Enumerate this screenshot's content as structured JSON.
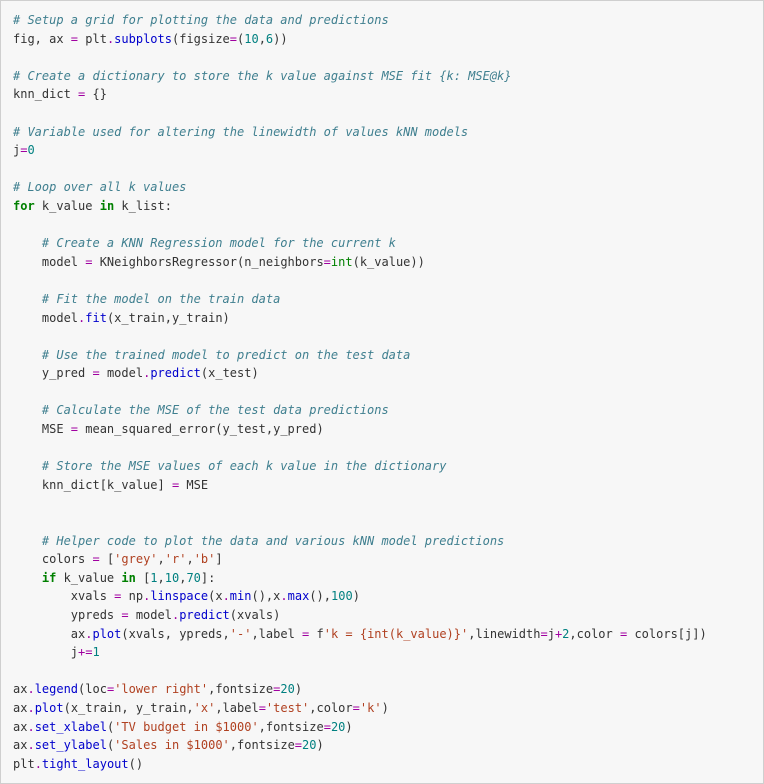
{
  "code": {
    "c1": "# Setup a grid for plotting the data and predictions",
    "l2a": "fig, ax ",
    "l2eq": "=",
    "l2b": " plt",
    "l2dot": ".",
    "l2fn": "subplots",
    "l2p1": "(figsize",
    "l2eq2": "=",
    "l2p2": "(",
    "l2n1": "10",
    "l2comma": ",",
    "l2n2": "6",
    "l2p3": "))",
    "c3": "# Create a dictionary to store the k value against MSE fit {k: MSE@k}",
    "l4a": "knn_dict ",
    "l4eq": "=",
    "l4b": " {}",
    "c5": "# Variable used for altering the linewidth of values kNN models",
    "l6a": "j",
    "l6eq": "=",
    "l6n": "0",
    "c7": "# Loop over all k values",
    "l8for": "for",
    "l8a": " k_value ",
    "l8in": "in",
    "l8b": " k_list:",
    "c9": "    # Create a KNN Regression model for the current k",
    "l10a": "    model ",
    "l10eq": "=",
    "l10b": " KNeighborsRegressor(n_neighbors",
    "l10eq2": "=",
    "l10int": "int",
    "l10c": "(k_value))",
    "c11": "    # Fit the model on the train data",
    "l12a": "    model",
    "l12dot": ".",
    "l12fn": "fit",
    "l12b": "(x_train,y_train)",
    "c13": "    # Use the trained model to predict on the test data",
    "l14a": "    y_pred ",
    "l14eq": "=",
    "l14b": " model",
    "l14dot": ".",
    "l14fn": "predict",
    "l14c": "(x_test)",
    "c15": "    # Calculate the MSE of the test data predictions",
    "l16a": "    MSE ",
    "l16eq": "=",
    "l16b": " mean_squared_error(y_test,y_pred)",
    "c17": "    # Store the MSE values of each k value in the dictionary",
    "l18a": "    knn_dict[k_value] ",
    "l18eq": "=",
    "l18b": " MSE",
    "c19": "    # Helper code to plot the data and various kNN model predictions",
    "l20a": "    colors ",
    "l20eq": "=",
    "l20b": " [",
    "l20s1": "'grey'",
    "l20c1": ",",
    "l20s2": "'r'",
    "l20c2": ",",
    "l20s3": "'b'",
    "l20b2": "]",
    "l21a": "    ",
    "l21if": "if",
    "l21b": " k_value ",
    "l21in": "in",
    "l21c": " [",
    "l21n1": "1",
    "l21c1": ",",
    "l21n2": "10",
    "l21c2": ",",
    "l21n3": "70",
    "l21d": "]:",
    "l22a": "        xvals ",
    "l22eq": "=",
    "l22b": " np",
    "l22dot": ".",
    "l22fn": "linspace",
    "l22c": "(x",
    "l22dot2": ".",
    "l22fn2": "min",
    "l22d": "(),x",
    "l22dot3": ".",
    "l22fn3": "max",
    "l22e": "(),",
    "l22n": "100",
    "l22f": ")",
    "l23a": "        ypreds ",
    "l23eq": "=",
    "l23b": " model",
    "l23dot": ".",
    "l23fn": "predict",
    "l23c": "(xvals)",
    "l24a": "        ax",
    "l24dot": ".",
    "l24fn": "plot",
    "l24b": "(xvals, ypreds,",
    "l24s1": "'-'",
    "l24c": ",label ",
    "l24eq": "=",
    "l24d": " f",
    "l24s2": "'k = {int(k_value)}'",
    "l24e": ",linewidth",
    "l24eq2": "=",
    "l24f": "j",
    "l24plus": "+",
    "l24n": "2",
    "l24g": ",color ",
    "l24eq3": "=",
    "l24h": " colors[j])",
    "l25a": "        j",
    "l25op": "+=",
    "l25n": "1",
    "l26a": "ax",
    "l26dot": ".",
    "l26fn": "legend",
    "l26b": "(loc",
    "l26eq": "=",
    "l26s": "'lower right'",
    "l26c": ",fontsize",
    "l26eq2": "=",
    "l26n": "20",
    "l26d": ")",
    "l27a": "ax",
    "l27dot": ".",
    "l27fn": "plot",
    "l27b": "(x_train, y_train,",
    "l27s1": "'x'",
    "l27c": ",label",
    "l27eq": "=",
    "l27s2": "'test'",
    "l27d": ",color",
    "l27eq2": "=",
    "l27s3": "'k'",
    "l27e": ")",
    "l28a": "ax",
    "l28dot": ".",
    "l28fn": "set_xlabel",
    "l28b": "(",
    "l28s": "'TV budget in $1000'",
    "l28c": ",fontsize",
    "l28eq": "=",
    "l28n": "20",
    "l28d": ")",
    "l29a": "ax",
    "l29dot": ".",
    "l29fn": "set_ylabel",
    "l29b": "(",
    "l29s": "'Sales in $1000'",
    "l29c": ",fontsize",
    "l29eq": "=",
    "l29n": "20",
    "l29d": ")",
    "l30a": "plt",
    "l30dot": ".",
    "l30fn": "tight_layout",
    "l30b": "()"
  }
}
